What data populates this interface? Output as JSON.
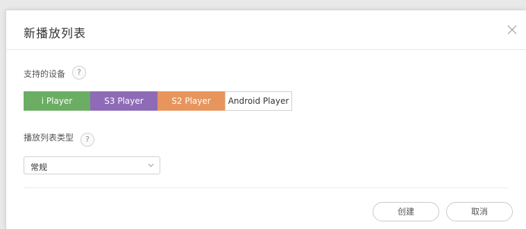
{
  "dialog": {
    "title": "新播放列表",
    "close_icon": "close-icon"
  },
  "devices": {
    "label": "支持的设备",
    "help": "?",
    "players": [
      {
        "label": "i Player",
        "color": "#6aad63",
        "text_color": "#ffffff",
        "selected": true
      },
      {
        "label": "S3 Player",
        "color": "#8e6bb7",
        "text_color": "#ffffff",
        "selected": true
      },
      {
        "label": "S2 Player",
        "color": "#e8955d",
        "text_color": "#ffffff",
        "selected": true
      },
      {
        "label": "Android Player",
        "color": "#ffffff",
        "text_color": "#333333",
        "selected": false
      }
    ]
  },
  "playlist_type": {
    "label": "播放列表类型",
    "help": "?",
    "selected_value": "常规",
    "chevron_icon": "chevron-down-icon"
  },
  "footer": {
    "create_label": "创建",
    "cancel_label": "取消"
  }
}
